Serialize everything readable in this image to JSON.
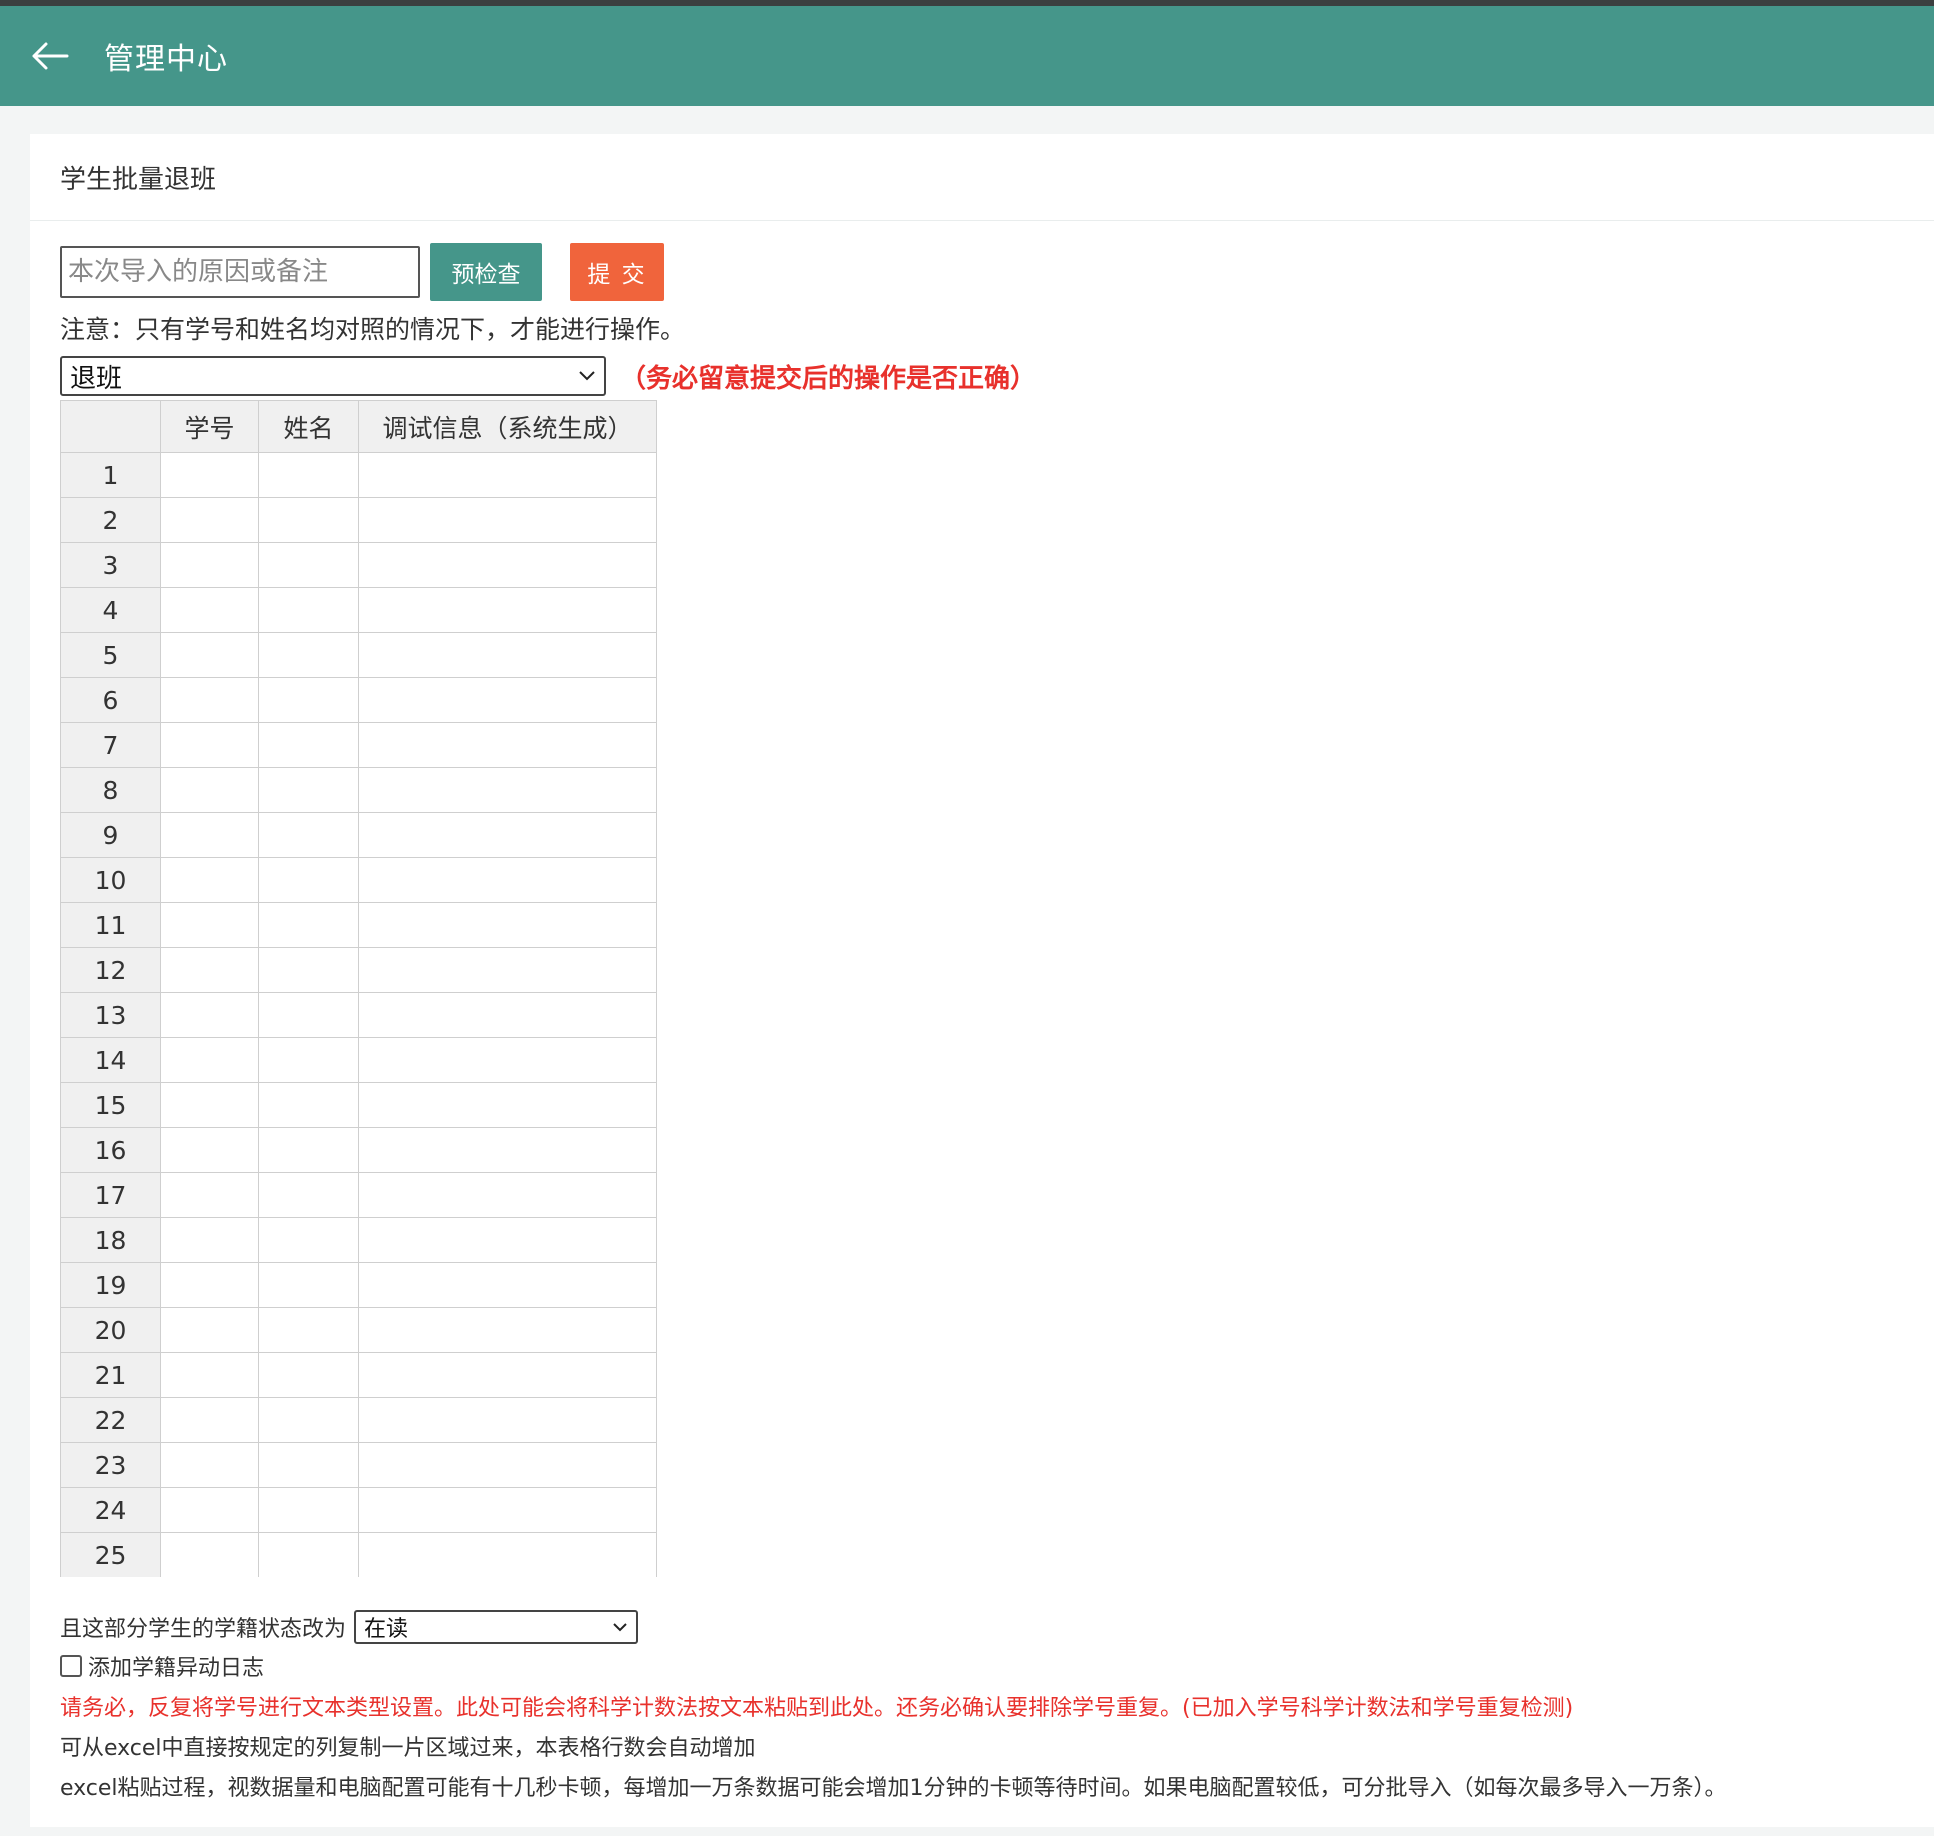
{
  "header": {
    "title": "管理中心",
    "back_icon": "arrow-left-icon"
  },
  "card": {
    "title": "学生批量退班"
  },
  "toolbar": {
    "remark_placeholder": "本次导入的原因或备注",
    "precheck_label": "预检查",
    "submit_label": "提 交"
  },
  "notice": "注意：只有学号和姓名均对照的情况下，才能进行操作。",
  "operation": {
    "selected": "退班",
    "warning": "（务必留意提交后的操作是否正确）"
  },
  "grid": {
    "columns": [
      "学号",
      "姓名",
      "调试信息（系统生成）"
    ],
    "rows": [
      "1",
      "2",
      "3",
      "4",
      "5",
      "6",
      "7",
      "8",
      "9",
      "10",
      "11",
      "12",
      "13",
      "14",
      "15",
      "16",
      "17",
      "18",
      "19",
      "20",
      "21",
      "22",
      "23",
      "24",
      "25"
    ]
  },
  "status": {
    "label": "且这部分学生的学籍状态改为",
    "selected": "在读"
  },
  "log_checkbox": {
    "label": "添加学籍异动日志",
    "checked": false
  },
  "notes": {
    "red": "请务必，反复将学号进行文本类型设置。此处可能会将科学计数法按文本粘贴到此处。还务必确认要排除学号重复。(已加入学号科学计数法和学号重复检测)",
    "line1": "可从excel中直接按规定的列复制一片区域过来，本表格行数会自动增加",
    "line2": "excel粘贴过程，视数据量和电脑配置可能有十几秒卡顿，每增加一万条数据可能会增加1分钟的卡顿等待时间。如果电脑配置较低，可分批导入（如每次最多导入一万条）。"
  },
  "colors": {
    "header_bg": "#45968a",
    "precheck_btn": "#45968a",
    "submit_btn": "#f0643c",
    "warning_red": "#e8312c"
  }
}
